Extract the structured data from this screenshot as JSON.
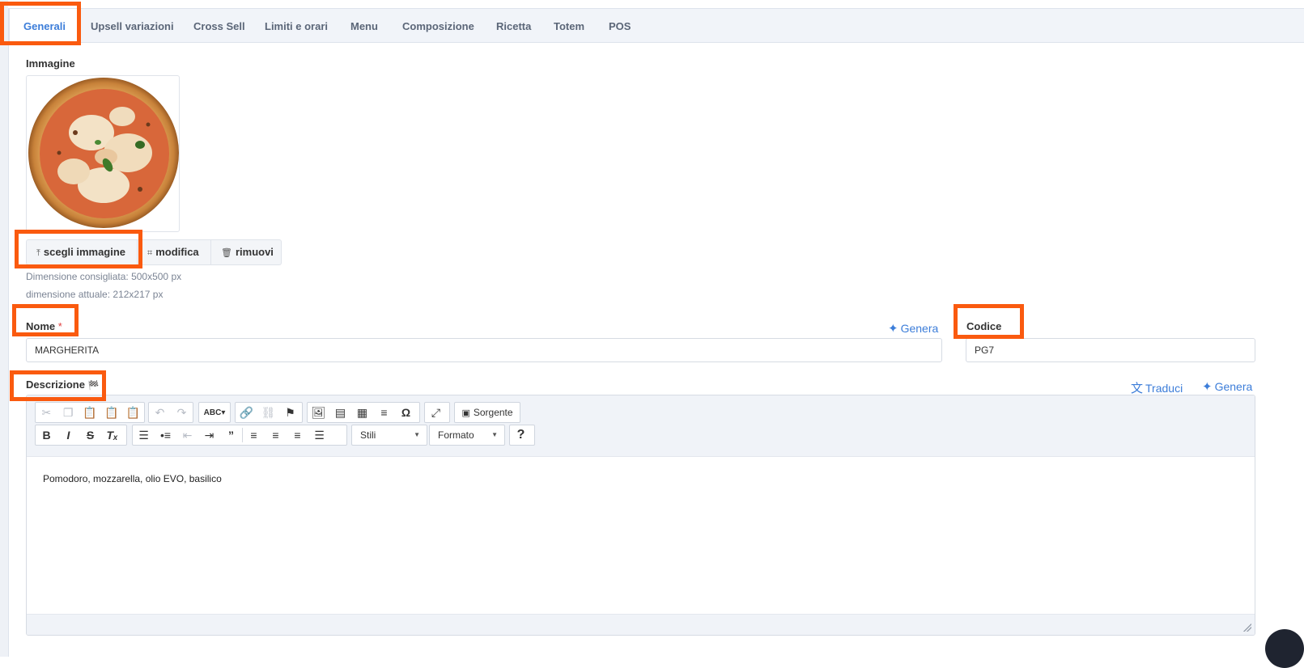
{
  "tabs": [
    {
      "label": "Generali"
    },
    {
      "label": "Upsell variazioni"
    },
    {
      "label": "Cross Sell"
    },
    {
      "label": "Limiti e orari"
    },
    {
      "label": "Menu"
    },
    {
      "label": "Composizione"
    },
    {
      "label": "Ricetta"
    },
    {
      "label": "Totem"
    },
    {
      "label": "POS"
    }
  ],
  "active_tab": "Generali",
  "image_section": {
    "label": "Immagine",
    "buttons": {
      "choose": "scegli immagine",
      "edit": "modifica",
      "remove": "rimuovi"
    },
    "recommended_size": "Dimensione consigliata: 500x500 px",
    "current_size": "dimensione attuale: 212x217 px"
  },
  "fields": {
    "name": {
      "label": "Nome",
      "required_mark": "*",
      "value": "MARGHERITA",
      "generate_label": "Genera"
    },
    "code": {
      "label": "Codice",
      "value": "PG7"
    },
    "description": {
      "label": "Descrizione",
      "translate_label": "Traduci",
      "generate_label": "Genera",
      "content": "Pomodoro, mozzarella, olio EVO, basilico"
    }
  },
  "editor_toolbar": {
    "source_label": "Sorgente",
    "styles_combo": "Stili",
    "format_combo": "Formato",
    "help_label": "?"
  },
  "colors": {
    "accent": "#3c7dd9",
    "highlight": "#fa5a0f"
  }
}
